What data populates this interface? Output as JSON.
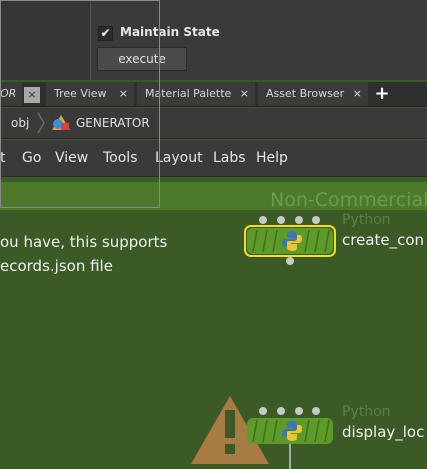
{
  "parameters": {
    "checkbox_mark": "✔",
    "maintain_state_label": "Maintain State",
    "maintain_state_checked": true,
    "execute_label": "execute"
  },
  "tabs": {
    "cut_label": "OR",
    "cut_close": "×",
    "items": [
      {
        "label": "Tree View",
        "close": "×"
      },
      {
        "label": "Material Palette",
        "close": "×"
      },
      {
        "label": "Asset Browser",
        "close": "×"
      }
    ],
    "add_label": "+"
  },
  "path_bar": {
    "obj": "obj",
    "generator": "GENERATOR"
  },
  "menu": [
    "t",
    "Go",
    "View",
    "Tools",
    "Layout",
    "Labs",
    "Help"
  ],
  "network": {
    "watermark": "Non-Commercial",
    "sticky_line1": "ou have, this supports",
    "sticky_line2": "ecords.json file",
    "nodes": [
      {
        "type": "Python",
        "name": "create_con"
      },
      {
        "type": "Python",
        "name": "display_loc"
      }
    ]
  },
  "colors": {
    "network_bg": "#3c5a26",
    "node_fill": "#5e9a2a",
    "selected_outline": "#f5dc1e",
    "warning": "#b07a3c"
  }
}
